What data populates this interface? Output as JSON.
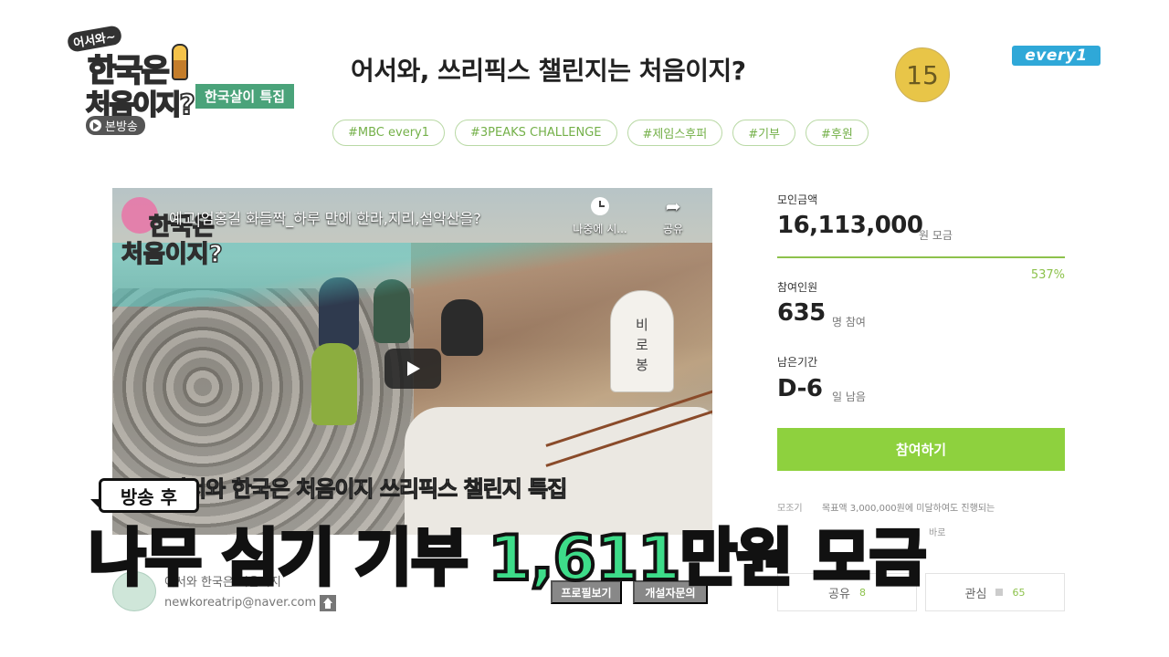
{
  "logo": {
    "top": "어서와~",
    "line1": "한국은",
    "line2": "처음이지?",
    "special_tag": "한국살이 특집",
    "onair_label": "본방송"
  },
  "header": {
    "title": "어서와, 쓰리픽스 챌린지는 처음이지?",
    "episode_number": "15",
    "channel_logo": "every1",
    "hashtags": [
      "#MBC every1",
      "#3PEAKS CHALLENGE",
      "#제임스후퍼",
      "#기부",
      "#후원"
    ]
  },
  "video": {
    "title": "예고|엄홍길 화들짝_하루 만에 한라,지리,설악산을?",
    "corner_logo_line1": "한국은",
    "corner_logo_line2": "처음이지?",
    "watch_later_label": "나중에 시...",
    "share_label": "공유",
    "marker_text": "비로봉",
    "subtitle": "어서와 한국은 처음이지 쓰리픽스 챌린지 특집"
  },
  "organizer": {
    "name": "어서와 한국은 처음이지",
    "email": "newkoreatrip@naver.com",
    "profile_button": "프로필보기",
    "consult_button": "개설자문의"
  },
  "funding": {
    "amount_label": "모인금액",
    "amount_value": "16,113,000",
    "amount_unit": "원 모금",
    "progress_percent": 537,
    "progress_label": "537%",
    "participants_label": "참여인원",
    "participants_value": "635",
    "participants_unit": "명 참여",
    "remaining_label": "남은기간",
    "remaining_value": "D-6",
    "remaining_unit": "일 남음",
    "join_button": "참여하기",
    "notice_label": "모조기",
    "notice_text": "목표액 3,000,000원에 미달하여도 진행되는",
    "notice_text2": "바로",
    "share_label": "공유",
    "share_count": "8",
    "like_label": "관심",
    "like_count": "65"
  },
  "overlay": {
    "after_tag": "방송 후",
    "caption_main": "나무 심기 기부",
    "caption_highlight": "1,611만원 모금"
  },
  "colors": {
    "accent_green": "#8ed13e",
    "hashtag_green": "#74b049",
    "caption_highlight": "#3ddc89",
    "channel_blue": "#2fa8d8",
    "episode_gold": "#e8c548"
  }
}
